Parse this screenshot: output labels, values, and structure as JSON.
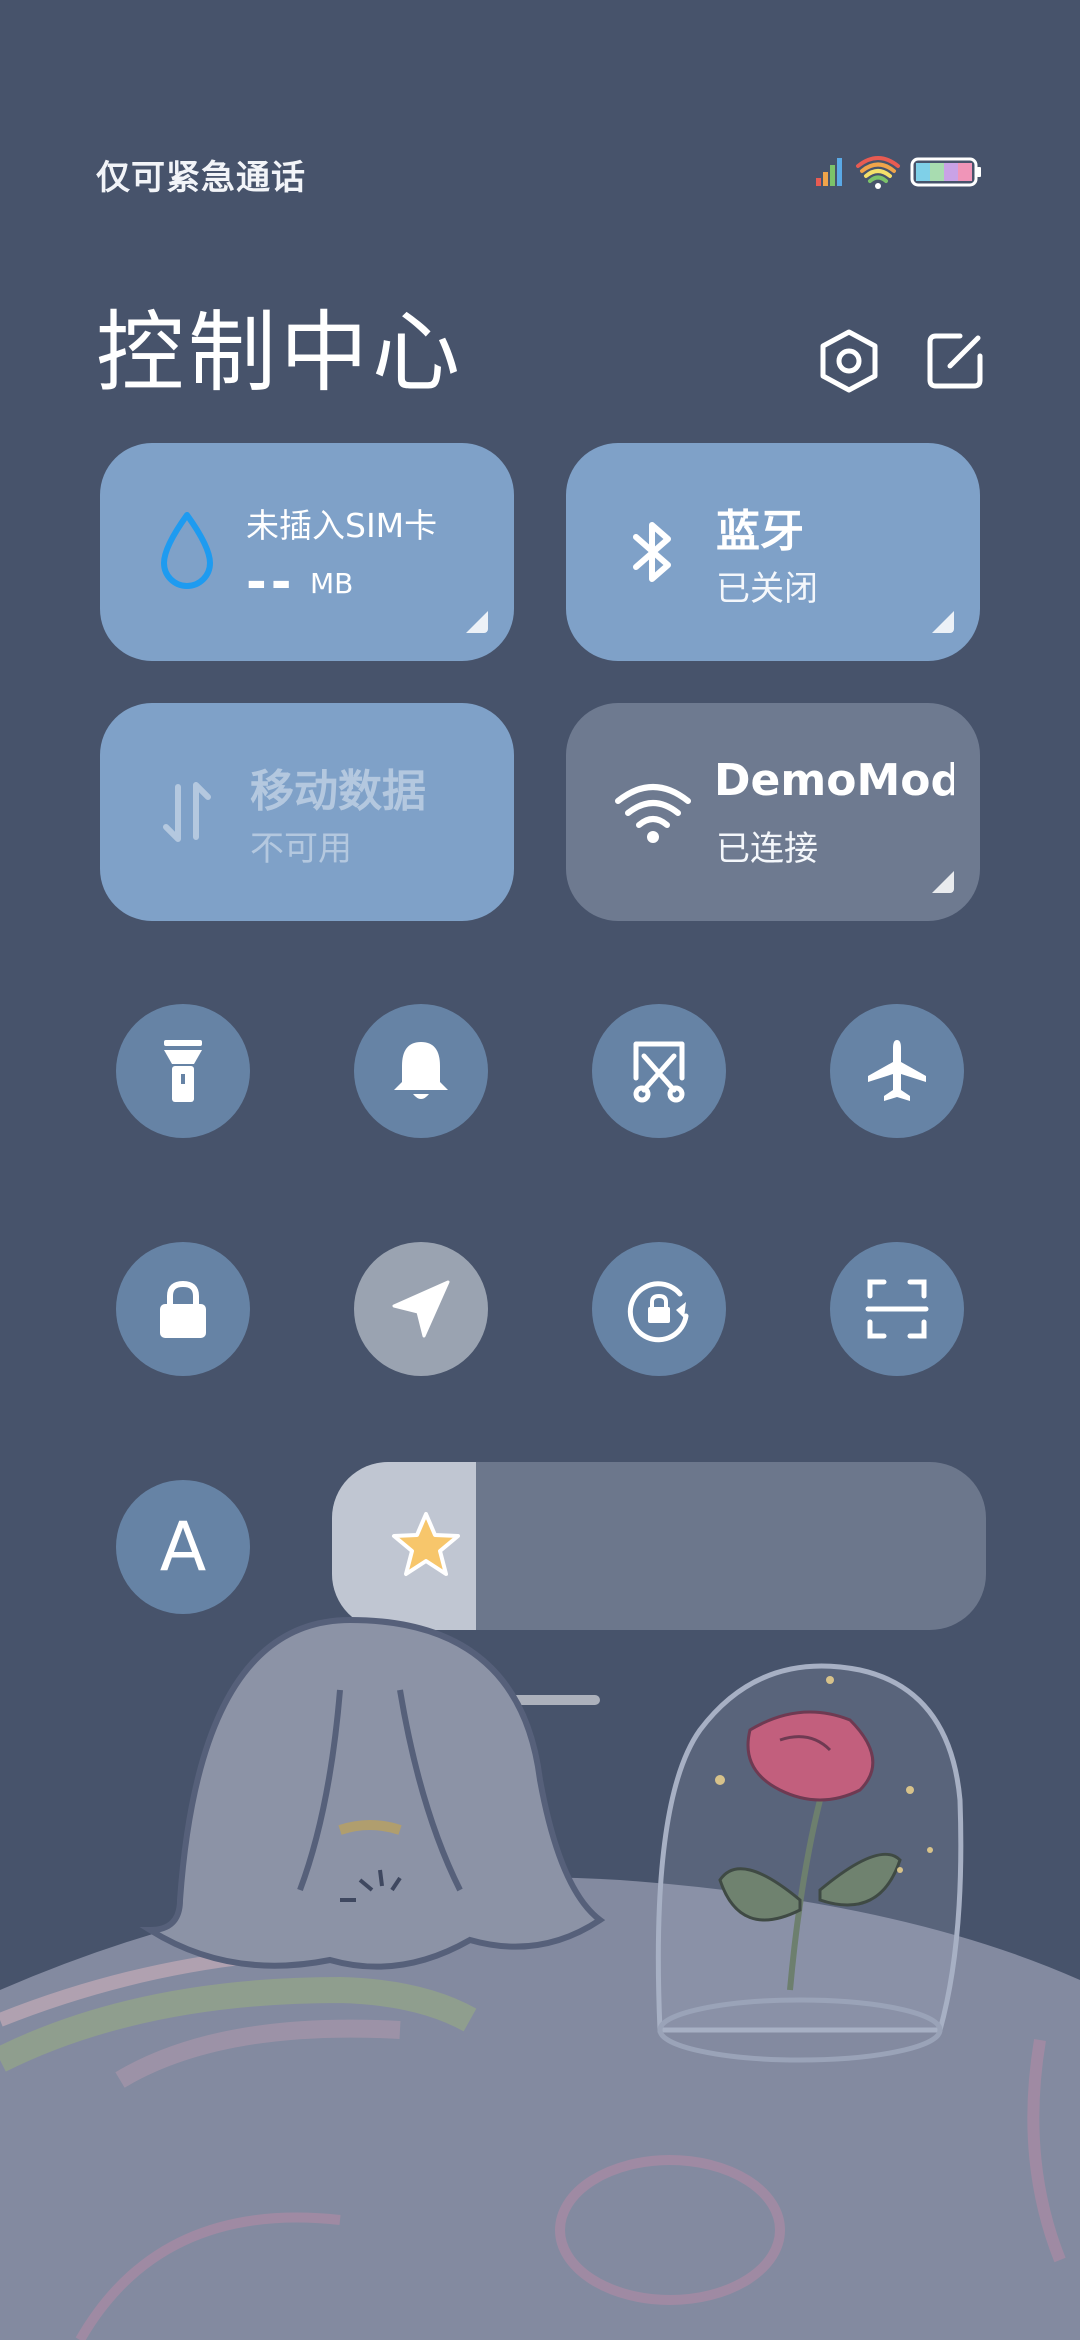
{
  "status_bar": {
    "carrier_text": "仅可紧急通话",
    "icons": [
      "signal-icon",
      "wifi-rainbow-icon",
      "battery-icon"
    ]
  },
  "header": {
    "title": "控制中心",
    "settings_icon": "settings-hexagon-icon",
    "edit_icon": "edit-icon"
  },
  "tiles": {
    "sim": {
      "label": "未插入SIM卡",
      "value": "--",
      "unit": "MB",
      "icon": "water-drop-icon"
    },
    "bluetooth": {
      "title": "蓝牙",
      "status": "已关闭",
      "icon": "bluetooth-icon"
    },
    "mobile_data": {
      "title": "移动数据",
      "status": "不可用",
      "icon": "data-arrows-icon"
    },
    "wifi": {
      "title": "DemoMod",
      "status": "已连接",
      "icon": "wifi-icon"
    }
  },
  "toggles": [
    {
      "name": "flashlight",
      "icon": "flashlight-icon",
      "active": false
    },
    {
      "name": "ringer",
      "icon": "bell-icon",
      "active": false
    },
    {
      "name": "screenshot",
      "icon": "scissors-screenshot-icon",
      "active": false
    },
    {
      "name": "airplane",
      "icon": "airplane-icon",
      "active": false
    },
    {
      "name": "lock-screen",
      "icon": "lock-icon",
      "active": false
    },
    {
      "name": "location",
      "icon": "location-arrow-icon",
      "active": true
    },
    {
      "name": "rotation-lock",
      "icon": "rotation-lock-icon",
      "active": false
    },
    {
      "name": "scanner",
      "icon": "scan-icon",
      "active": false
    }
  ],
  "auto_brightness": {
    "label": "A",
    "icon": "auto-brightness-icon"
  },
  "brightness": {
    "level_fraction": 0.22,
    "icon": "star-sun-icon"
  },
  "colors": {
    "background": "#47536b",
    "tile": "#7fa1c8",
    "tile_active": "#6e7a90",
    "toggle": "#6683a5",
    "toggle_active": "#9aa3b1",
    "drop_icon": "#1e9bf0",
    "star": "#f7c66b"
  }
}
